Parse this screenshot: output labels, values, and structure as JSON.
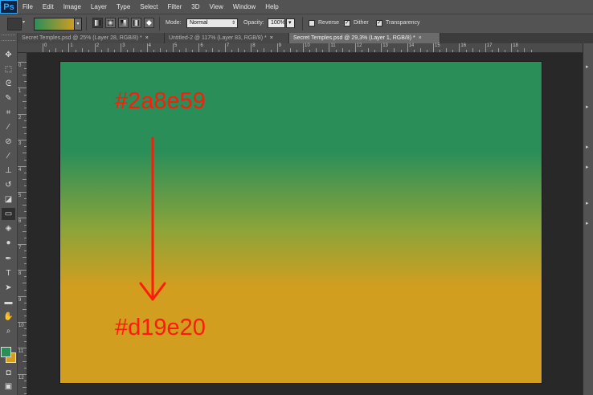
{
  "app": {
    "logo": "Ps"
  },
  "menu": [
    "File",
    "Edit",
    "Image",
    "Layer",
    "Type",
    "Select",
    "Filter",
    "3D",
    "View",
    "Window",
    "Help"
  ],
  "options_bar": {
    "gradient_colors": [
      "#2a8e59",
      "#d19e20"
    ],
    "mode_label": "Mode:",
    "mode_value": "Normal",
    "opacity_label": "Opacity:",
    "opacity_value": "100%",
    "reverse_label": "Reverse",
    "reverse_checked": false,
    "dither_label": "Dither",
    "dither_checked": true,
    "transparency_label": "Transparency",
    "transparency_checked": true,
    "checkmark": "✓",
    "gradient_types": [
      "linear-gradient-icon",
      "radial-gradient-icon",
      "angle-gradient-icon",
      "reflected-gradient-icon",
      "diamond-gradient-icon"
    ]
  },
  "tabs": [
    {
      "label": "Secret Temples.psd @ 25% (Layer 28, RGB/8) *",
      "close": "×",
      "active": false
    },
    {
      "label": "Untitled-2 @ 117% (Layer 83, RGB/8) *",
      "close": "×",
      "active": false
    },
    {
      "label": "Secret Temples.psd @ 29,3% (Layer 1, RGB/8) *",
      "close": "×",
      "active": true
    }
  ],
  "rulers": {
    "top_numbers": [
      "0",
      "1",
      "2",
      "3",
      "4",
      "5",
      "6",
      "7",
      "8",
      "9",
      "10",
      "11",
      "12",
      "13",
      "14",
      "15",
      "16",
      "17",
      "18"
    ],
    "left_numbers": [
      "0",
      "1",
      "2",
      "3",
      "4",
      "5",
      "6",
      "7",
      "8",
      "9",
      "10",
      "11",
      "12"
    ]
  },
  "tools": [
    "move-icon",
    "marquee-icon",
    "lasso-icon",
    "quick-select-icon",
    "crop-icon",
    "eyedropper-icon",
    "healing-brush-icon",
    "brush-icon",
    "clone-stamp-icon",
    "history-brush-icon",
    "eraser-icon",
    "gradient-icon",
    "blur-icon",
    "dodge-icon",
    "pen-icon",
    "type-icon",
    "path-select-icon",
    "rectangle-icon",
    "hand-icon",
    "zoom-icon"
  ],
  "swatches": {
    "foreground": "#2a8e59",
    "background": "#d19e20"
  },
  "canvas": {
    "top_color_label": "#2a8e59",
    "bottom_color_label": "#d19e20",
    "gradient_start": "#2a8e59",
    "gradient_end": "#d19e20",
    "annotation_color": "#ff1a0a"
  }
}
